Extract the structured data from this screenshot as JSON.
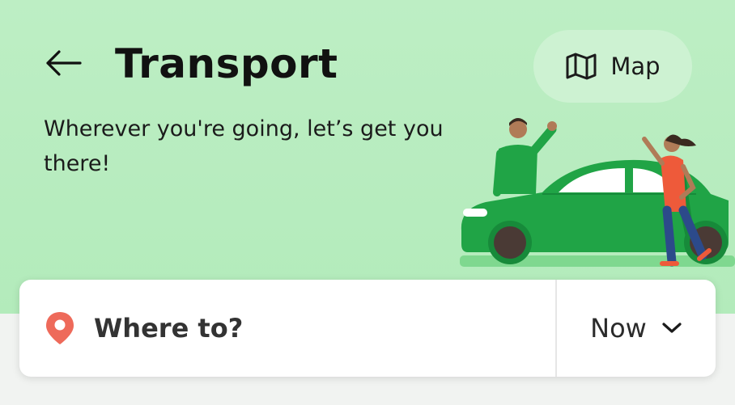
{
  "header": {
    "title": "Transport",
    "subtitle": "Wherever you're going, let’s get you there!",
    "map_label": "Map"
  },
  "search": {
    "where_label": "Where to?",
    "time_label": "Now"
  },
  "colors": {
    "hero_background": "#b8edc0",
    "car": "#20a446",
    "pin": "#ee6a5a"
  },
  "icons": [
    "back-arrow-icon",
    "map-icon",
    "location-pin-icon",
    "chevron-down-icon"
  ]
}
